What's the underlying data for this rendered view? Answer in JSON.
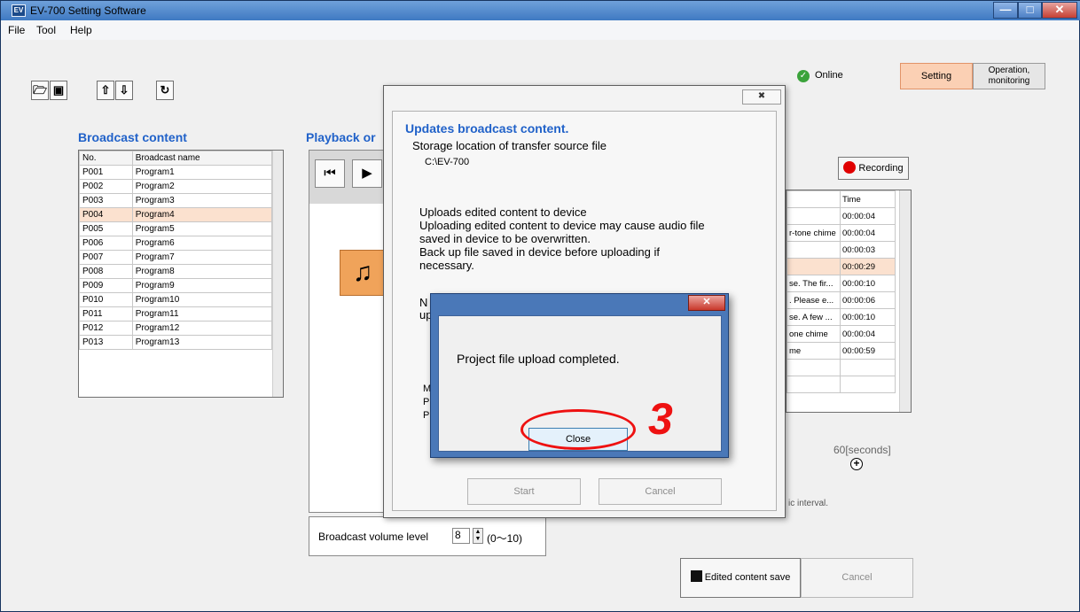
{
  "window": {
    "title": "EV-700 Setting Software",
    "app_icon": "EV"
  },
  "menu": [
    "File",
    "Tool",
    "Help"
  ],
  "toolbar": {
    "icons": [
      "open-folder-icon",
      "save-icon",
      "upload-icon",
      "download-icon",
      "refresh-device-icon"
    ]
  },
  "status": {
    "label": "Online",
    "color": "#3ba33b"
  },
  "mode_tabs": {
    "setting": "Setting",
    "operation": "Operation,\nmonitoring"
  },
  "broadcast_content": {
    "title": "Broadcast content",
    "columns": [
      "No.",
      "Broadcast name"
    ],
    "rows": [
      [
        "P001",
        "Program1"
      ],
      [
        "P002",
        "Program2"
      ],
      [
        "P003",
        "Program3"
      ],
      [
        "P004",
        "Program4"
      ],
      [
        "P005",
        "Program5"
      ],
      [
        "P006",
        "Program6"
      ],
      [
        "P007",
        "Program7"
      ],
      [
        "P008",
        "Program8"
      ],
      [
        "P009",
        "Program9"
      ],
      [
        "P010",
        "Program10"
      ],
      [
        "P011",
        "Program11"
      ],
      [
        "P012",
        "Program12"
      ],
      [
        "P013",
        "Program13"
      ]
    ],
    "selected_index": 3
  },
  "playback": {
    "title": "Playback or"
  },
  "volume": {
    "label": "Broadcast volume level",
    "value": "8",
    "range": "(0〜10)"
  },
  "recording": {
    "button": "Recording",
    "time_header": "Time",
    "rows": [
      [
        "",
        "00:00:04"
      ],
      [
        "r-tone chime",
        "00:00:04"
      ],
      [
        "",
        "00:00:03"
      ],
      [
        "",
        "00:00:29"
      ],
      [
        "se. The fir...",
        "00:00:10"
      ],
      [
        ". Please e...",
        "00:00:06"
      ],
      [
        "se. A few ...",
        "00:00:10"
      ],
      [
        "one chime",
        "00:00:04"
      ],
      [
        "me",
        "00:00:59"
      ],
      [
        "",
        ""
      ],
      [
        "",
        ""
      ]
    ],
    "selected_index": 3,
    "seconds_label": "60[seconds]",
    "interval_label": "ic interval."
  },
  "bottom_buttons": {
    "save": "Edited content save",
    "cancel": "Cancel"
  },
  "update_dialog": {
    "title": "Updates broadcast content.",
    "storage_label": "Storage location of transfer source file",
    "storage_path": "C:\\EV-700",
    "paragraph_lines": [
      "Uploads edited content to device",
      "Uploading edited content to device may cause audio file",
      "saved in device to be overwritten.",
      "Back up file saved in device before uploading if",
      "necessary."
    ],
    "obscured_line_1": "N",
    "obscured_line_2": "up",
    "partial_lines": [
      "M",
      "P",
      "P"
    ],
    "start": "Start",
    "cancel": "Cancel"
  },
  "message_box": {
    "text": "Project file upload completed.",
    "ok": "Close"
  },
  "annotation": {
    "step": "3",
    "color": "#e11111"
  }
}
